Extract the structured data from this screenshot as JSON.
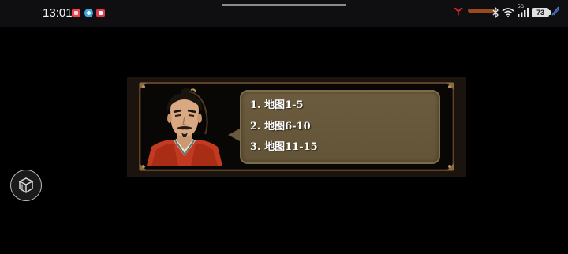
{
  "status_bar": {
    "time": "13:01",
    "network_type": "5G",
    "battery_level": "73",
    "notification_icons": [
      "app-notification-red-icon",
      "app-notification-blue-icon",
      "app-notification-red-square-icon"
    ],
    "colors": {
      "background": "#0f0f11",
      "notif_red": "#e8434f",
      "notif_blue": "#3fa7e0",
      "notif_red2": "#e23a4a"
    }
  },
  "floating_button": {
    "icon": "package-box-icon"
  },
  "dialog": {
    "portrait_icon": "general-portrait",
    "options": [
      {
        "label": "1. 地图1-5"
      },
      {
        "label": "2. 地图6-10"
      },
      {
        "label": "3. 地图11-15"
      }
    ],
    "colors": {
      "bubble": "#6a5a3d",
      "frame": "#5e4127",
      "text": "#ffffff"
    }
  }
}
